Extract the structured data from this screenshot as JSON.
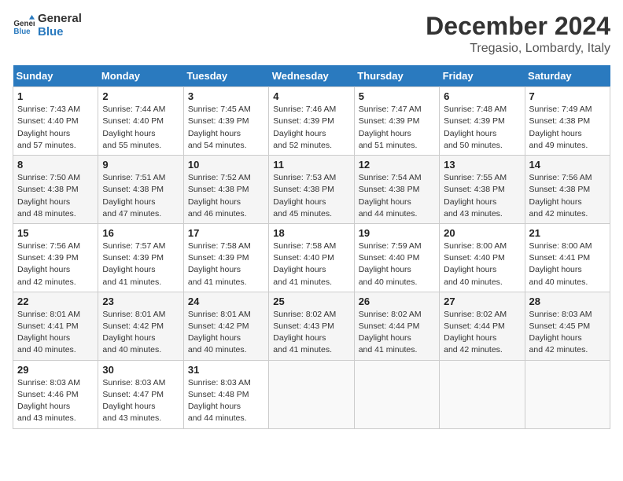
{
  "logo": {
    "line1": "General",
    "line2": "Blue"
  },
  "title": "December 2024",
  "location": "Tregasio, Lombardy, Italy",
  "weekdays": [
    "Sunday",
    "Monday",
    "Tuesday",
    "Wednesday",
    "Thursday",
    "Friday",
    "Saturday"
  ],
  "weeks": [
    [
      {
        "day": "1",
        "sunrise": "7:43 AM",
        "sunset": "4:40 PM",
        "daylight": "8 hours and 57 minutes."
      },
      {
        "day": "2",
        "sunrise": "7:44 AM",
        "sunset": "4:40 PM",
        "daylight": "8 hours and 55 minutes."
      },
      {
        "day": "3",
        "sunrise": "7:45 AM",
        "sunset": "4:39 PM",
        "daylight": "8 hours and 54 minutes."
      },
      {
        "day": "4",
        "sunrise": "7:46 AM",
        "sunset": "4:39 PM",
        "daylight": "8 hours and 52 minutes."
      },
      {
        "day": "5",
        "sunrise": "7:47 AM",
        "sunset": "4:39 PM",
        "daylight": "8 hours and 51 minutes."
      },
      {
        "day": "6",
        "sunrise": "7:48 AM",
        "sunset": "4:39 PM",
        "daylight": "8 hours and 50 minutes."
      },
      {
        "day": "7",
        "sunrise": "7:49 AM",
        "sunset": "4:38 PM",
        "daylight": "8 hours and 49 minutes."
      }
    ],
    [
      {
        "day": "8",
        "sunrise": "7:50 AM",
        "sunset": "4:38 PM",
        "daylight": "8 hours and 48 minutes."
      },
      {
        "day": "9",
        "sunrise": "7:51 AM",
        "sunset": "4:38 PM",
        "daylight": "8 hours and 47 minutes."
      },
      {
        "day": "10",
        "sunrise": "7:52 AM",
        "sunset": "4:38 PM",
        "daylight": "8 hours and 46 minutes."
      },
      {
        "day": "11",
        "sunrise": "7:53 AM",
        "sunset": "4:38 PM",
        "daylight": "8 hours and 45 minutes."
      },
      {
        "day": "12",
        "sunrise": "7:54 AM",
        "sunset": "4:38 PM",
        "daylight": "8 hours and 44 minutes."
      },
      {
        "day": "13",
        "sunrise": "7:55 AM",
        "sunset": "4:38 PM",
        "daylight": "8 hours and 43 minutes."
      },
      {
        "day": "14",
        "sunrise": "7:56 AM",
        "sunset": "4:38 PM",
        "daylight": "8 hours and 42 minutes."
      }
    ],
    [
      {
        "day": "15",
        "sunrise": "7:56 AM",
        "sunset": "4:39 PM",
        "daylight": "8 hours and 42 minutes."
      },
      {
        "day": "16",
        "sunrise": "7:57 AM",
        "sunset": "4:39 PM",
        "daylight": "8 hours and 41 minutes."
      },
      {
        "day": "17",
        "sunrise": "7:58 AM",
        "sunset": "4:39 PM",
        "daylight": "8 hours and 41 minutes."
      },
      {
        "day": "18",
        "sunrise": "7:58 AM",
        "sunset": "4:40 PM",
        "daylight": "8 hours and 41 minutes."
      },
      {
        "day": "19",
        "sunrise": "7:59 AM",
        "sunset": "4:40 PM",
        "daylight": "8 hours and 40 minutes."
      },
      {
        "day": "20",
        "sunrise": "8:00 AM",
        "sunset": "4:40 PM",
        "daylight": "8 hours and 40 minutes."
      },
      {
        "day": "21",
        "sunrise": "8:00 AM",
        "sunset": "4:41 PM",
        "daylight": "8 hours and 40 minutes."
      }
    ],
    [
      {
        "day": "22",
        "sunrise": "8:01 AM",
        "sunset": "4:41 PM",
        "daylight": "8 hours and 40 minutes."
      },
      {
        "day": "23",
        "sunrise": "8:01 AM",
        "sunset": "4:42 PM",
        "daylight": "8 hours and 40 minutes."
      },
      {
        "day": "24",
        "sunrise": "8:01 AM",
        "sunset": "4:42 PM",
        "daylight": "8 hours and 40 minutes."
      },
      {
        "day": "25",
        "sunrise": "8:02 AM",
        "sunset": "4:43 PM",
        "daylight": "8 hours and 41 minutes."
      },
      {
        "day": "26",
        "sunrise": "8:02 AM",
        "sunset": "4:44 PM",
        "daylight": "8 hours and 41 minutes."
      },
      {
        "day": "27",
        "sunrise": "8:02 AM",
        "sunset": "4:44 PM",
        "daylight": "8 hours and 42 minutes."
      },
      {
        "day": "28",
        "sunrise": "8:03 AM",
        "sunset": "4:45 PM",
        "daylight": "8 hours and 42 minutes."
      }
    ],
    [
      {
        "day": "29",
        "sunrise": "8:03 AM",
        "sunset": "4:46 PM",
        "daylight": "8 hours and 43 minutes."
      },
      {
        "day": "30",
        "sunrise": "8:03 AM",
        "sunset": "4:47 PM",
        "daylight": "8 hours and 43 minutes."
      },
      {
        "day": "31",
        "sunrise": "8:03 AM",
        "sunset": "4:48 PM",
        "daylight": "8 hours and 44 minutes."
      },
      null,
      null,
      null,
      null
    ]
  ]
}
